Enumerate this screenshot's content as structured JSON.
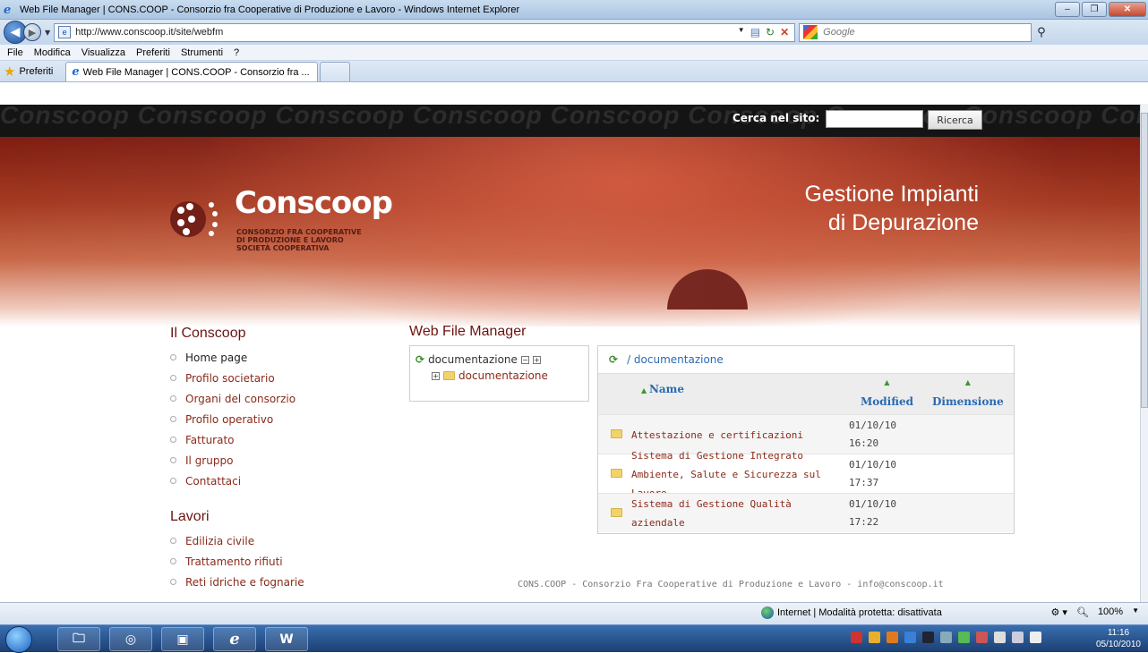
{
  "window": {
    "title": "Web File Manager | CONS.COOP - Consorzio fra Cooperative di Produzione e Lavoro - Windows Internet Explorer",
    "url": "http://www.conscoop.it/site/webfm",
    "search_placeholder": "Google",
    "menu": [
      "File",
      "Modifica",
      "Visualizza",
      "Preferiti",
      "Strumenti",
      "?"
    ],
    "favorites_label": "Preferiti",
    "tab_title": "Web File Manager | CONS.COOP - Consorzio fra ..."
  },
  "site": {
    "watermark": "Conscoop Conscoop Conscoop Conscoop Conscoop Conscoop Conscoop Conscoop Conscoop Conscoop Conscoop",
    "search_label": "Cerca nel sito:",
    "search_button": "Ricerca",
    "logo_word": "Conscoop",
    "logo_sub_1": "CONSORZIO FRA COOPERATIVE",
    "logo_sub_2": "DI PRODUZIONE E LAVORO",
    "logo_sub_3": "SOCIETÀ COOPERATIVA",
    "tagline_1": "Gestione Impianti",
    "tagline_2": "di Depurazione"
  },
  "sidebar": {
    "heading_1": "Il Conscoop",
    "items_1": [
      "Home page",
      "Profilo societario",
      "Organi del consorzio",
      "Profilo operativo",
      "Fatturato",
      "Il gruppo",
      "Contattaci"
    ],
    "heading_2": "Lavori",
    "items_2": [
      "Edilizia civile",
      "Trattamento rifiuti",
      "Reti idriche e fognarie"
    ]
  },
  "webfm": {
    "title": "Web File Manager",
    "tree_root": "documentazione",
    "tree_child": "documentazione",
    "path": "/ documentazione",
    "col_name": "Name",
    "col_modified": "Modified",
    "col_size": "Dimensione",
    "files": [
      {
        "name": "Attestazione e certificazioni",
        "date": "01/10/10",
        "time": "16:20"
      },
      {
        "name": "Sistema di Gestione Integrato Ambiente, Salute e Sicurezza sul Lavoro",
        "date": "01/10/10",
        "time": "17:37"
      },
      {
        "name": "Sistema di Gestione Qualità aziendale",
        "date": "01/10/10",
        "time": "17:22"
      }
    ]
  },
  "footer": "CONS.COOP - Consorzio Fra Cooperative di Produzione e Lavoro - info@conscoop.it",
  "statusbar": {
    "zone": "Internet | Modalità protetta: disattivata",
    "zoom": "100%"
  },
  "taskbar": {
    "time": "11:16",
    "date": "05/10/2010"
  }
}
